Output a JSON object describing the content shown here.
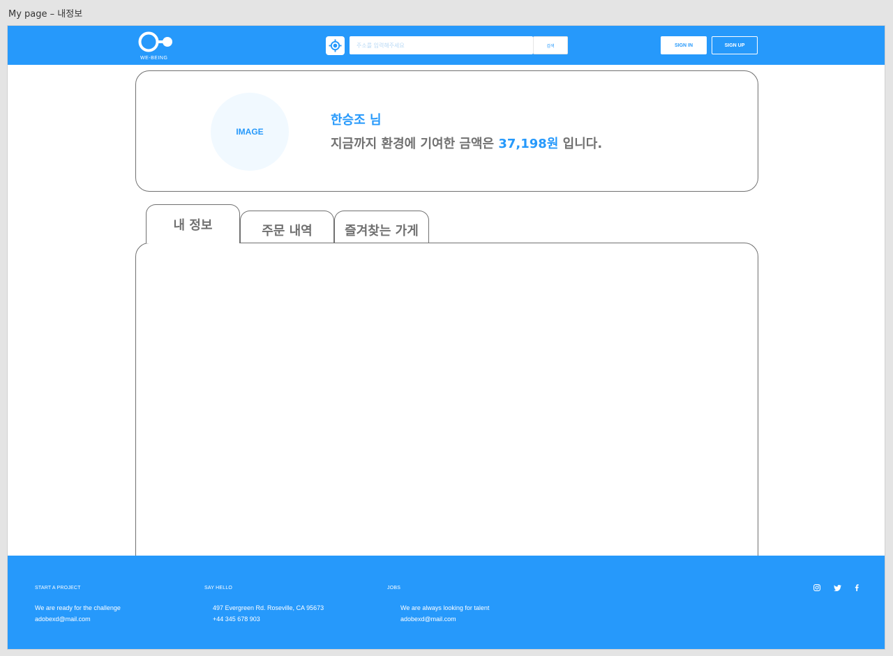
{
  "artboard_title": "My page – 내정보",
  "header": {
    "logo_text": "WE-BEING",
    "search_placeholder": "주소를 입력해주세요",
    "search_button": "검색",
    "sign_in": "SIGN IN",
    "sign_up": "SIGN UP"
  },
  "profile": {
    "image_label": "IMAGE",
    "user_name": "한승조 님",
    "contribution_prefix": "지금까지 환경에 기여한 금액은 ",
    "contribution_amount": "37,198원",
    "contribution_suffix": " 입니다."
  },
  "tabs": [
    {
      "label": "내 정보",
      "active": true
    },
    {
      "label": "주문 내역",
      "active": false
    },
    {
      "label": "즐겨찾는 가게",
      "active": false
    }
  ],
  "footer": {
    "col1": {
      "heading": "START A PROJECT",
      "line1": "We are ready for the challenge",
      "line2": "adobexd@mail.com"
    },
    "col2": {
      "heading": "SAY HELLO",
      "line1": "497 Evergreen Rd. Roseville, CA 95673",
      "line2": "+44 345 678 903"
    },
    "col3": {
      "heading": "JOBS",
      "line1": "We are always looking for talent",
      "line2": "adobexd@mail.com"
    },
    "social": [
      "instagram-icon",
      "twitter-icon",
      "facebook-icon"
    ]
  },
  "colors": {
    "brand": "#2699fb",
    "gray_text": "#707070",
    "avatar_bg": "#f1f9ff"
  }
}
